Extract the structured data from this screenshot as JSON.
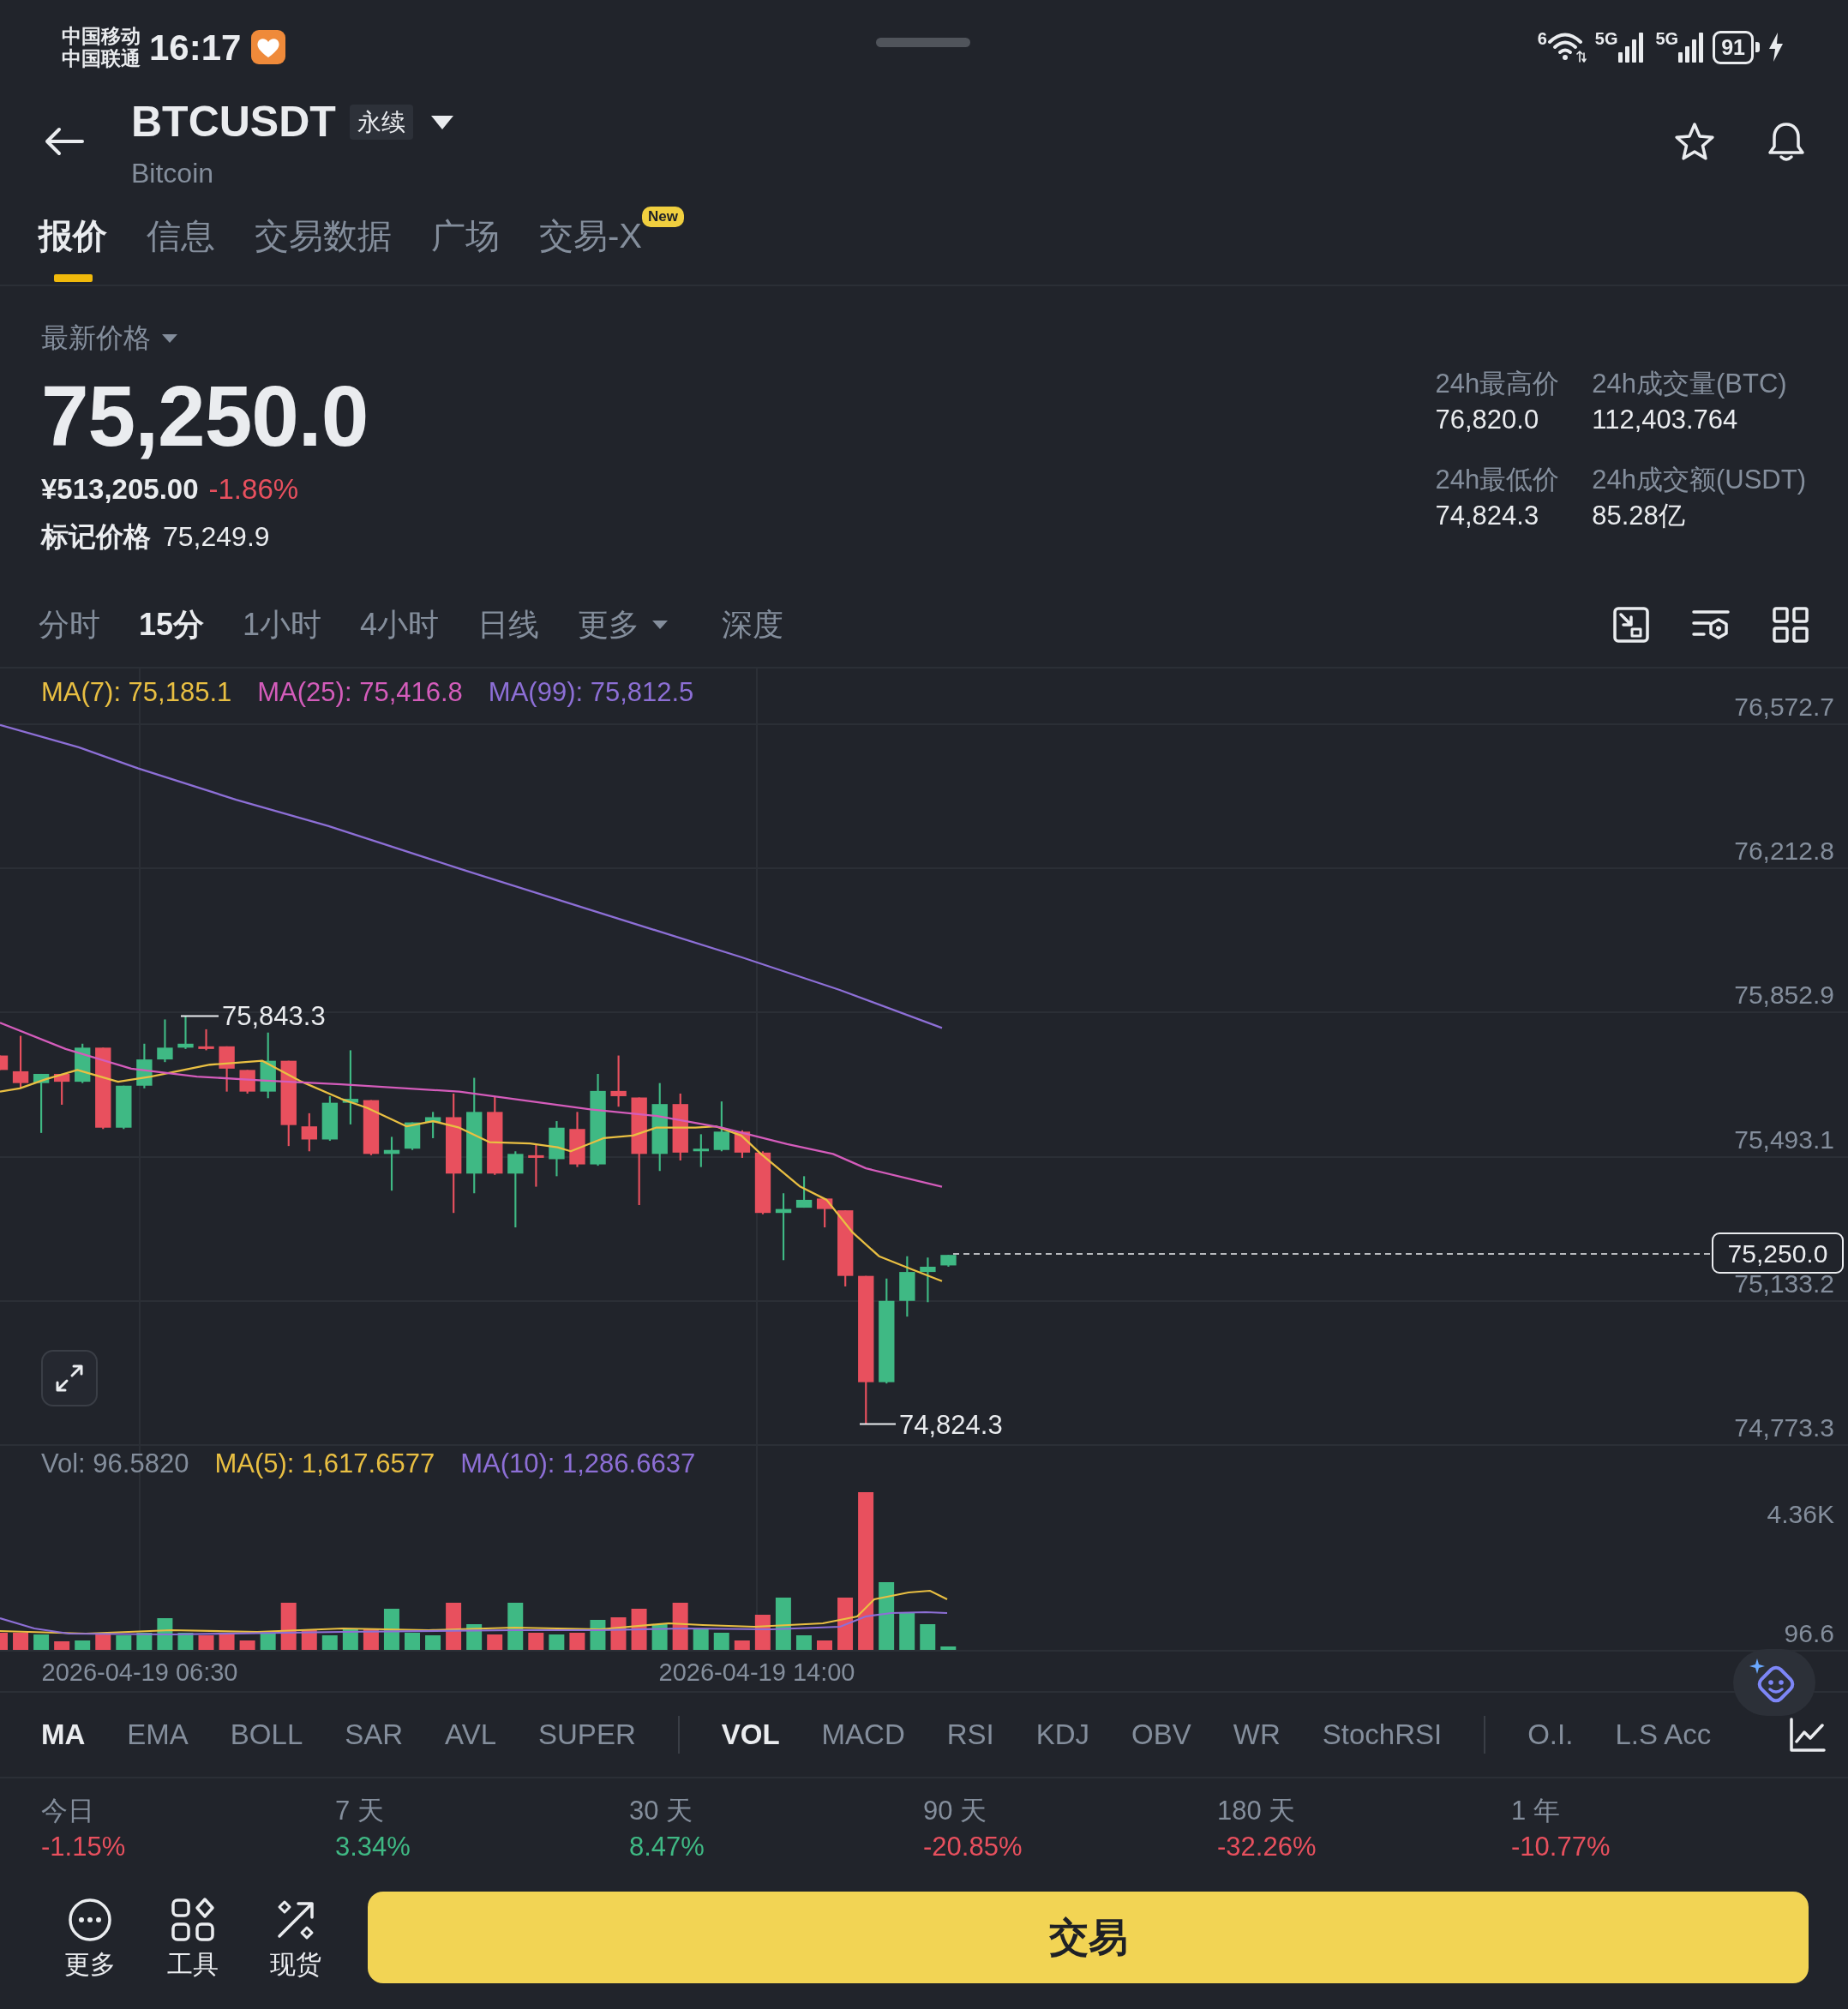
{
  "status_bar": {
    "carriers": [
      "中国移动",
      "中国联通"
    ],
    "time": "16:17",
    "wifi_label": "6",
    "signals": [
      {
        "label": "5G"
      },
      {
        "label": "5G"
      }
    ],
    "battery": "91",
    "charging": true
  },
  "header": {
    "title": "BTCUSDT",
    "badge": "永续",
    "subtitle": "Bitcoin"
  },
  "tabs": [
    {
      "label": "报价",
      "selected": true
    },
    {
      "label": "信息",
      "selected": false
    },
    {
      "label": "交易数据",
      "selected": false
    },
    {
      "label": "广场",
      "selected": false
    },
    {
      "label": "交易-X",
      "selected": false,
      "badge": "New"
    }
  ],
  "price": {
    "label": "最新价格",
    "value": "75,250.0",
    "cny_value": "¥513,205.00",
    "change": "-1.86%",
    "falling": true,
    "mark_label": "标记价格",
    "mark_value": "75,249.9"
  },
  "stats": [
    {
      "label": "24h最高价",
      "value": "76,820.0"
    },
    {
      "label": "24h成交量(BTC)",
      "value": "112,403.764"
    },
    {
      "label": "24h最低价",
      "value": "74,824.3"
    },
    {
      "label": "24h成交额(USDT)",
      "value": "85.28亿"
    }
  ],
  "intervals": [
    {
      "label": "分时",
      "selected": false,
      "kind": "option"
    },
    {
      "label": "15分",
      "selected": true,
      "kind": "option"
    },
    {
      "label": "1小时",
      "selected": false,
      "kind": "option"
    },
    {
      "label": "4小时",
      "selected": false,
      "kind": "option"
    },
    {
      "label": "日线",
      "selected": false,
      "kind": "option"
    },
    {
      "label": "更多",
      "selected": false,
      "kind": "menu"
    },
    {
      "label": "深度",
      "selected": false,
      "kind": "option"
    }
  ],
  "chart": {
    "legend": [
      {
        "label": "MA(7): 75,185.1",
        "color": "#e9bf42"
      },
      {
        "label": "MA(25): 75,416.8",
        "color": "#d45cbb"
      },
      {
        "label": "MA(99): 75,812.5",
        "color": "#8d6fd6"
      }
    ],
    "y_labels": [
      "76,572.7",
      "76,212.8",
      "75,852.9",
      "75,493.1",
      "75,133.2",
      "74,773.3"
    ],
    "high_label": "75,843.3",
    "low_label": "74,824.3",
    "price_tag": "75,250.0"
  },
  "volume": {
    "legend": [
      {
        "label": "Vol: 96.5820",
        "color": "#848e9c"
      },
      {
        "label": "MA(5): 1,617.6577",
        "color": "#e9bf42"
      },
      {
        "label": "MA(10): 1,286.6637",
        "color": "#8d6fd6"
      }
    ],
    "y_labels": [
      "4.36K",
      "96.6"
    ]
  },
  "x_labels": [
    "2026-04-19 06:30",
    "2026-04-19 14:00"
  ],
  "indicator_groups": [
    {
      "items": [
        {
          "label": "MA",
          "selected": true
        },
        {
          "label": "EMA",
          "selected": false
        },
        {
          "label": "BOLL",
          "selected": false
        },
        {
          "label": "SAR",
          "selected": false
        },
        {
          "label": "AVL",
          "selected": false
        },
        {
          "label": "SUPER",
          "selected": false
        }
      ]
    },
    {
      "items": [
        {
          "label": "VOL",
          "selected": true
        },
        {
          "label": "MACD",
          "selected": false
        },
        {
          "label": "RSI",
          "selected": false
        },
        {
          "label": "KDJ",
          "selected": false
        },
        {
          "label": "OBV",
          "selected": false
        },
        {
          "label": "WR",
          "selected": false
        },
        {
          "label": "StochRSI",
          "selected": false
        }
      ]
    },
    {
      "items": [
        {
          "label": "O.I.",
          "selected": false
        },
        {
          "label": "L.S Acc",
          "selected": false
        }
      ]
    }
  ],
  "returns": [
    {
      "period": "今日",
      "value": "-1.15%",
      "falling": true
    },
    {
      "period": "7 天",
      "value": "3.34%",
      "falling": false
    },
    {
      "period": "30 天",
      "value": "8.47%",
      "falling": false
    },
    {
      "period": "90 天",
      "value": "-20.85%",
      "falling": true
    },
    {
      "period": "180 天",
      "value": "-32.26%",
      "falling": true
    },
    {
      "period": "1 年",
      "value": "-10.77%",
      "falling": true
    }
  ],
  "bottom_nav": [
    {
      "label": "更多"
    },
    {
      "label": "工具"
    },
    {
      "label": "现货"
    }
  ],
  "trade_button": "交易"
}
